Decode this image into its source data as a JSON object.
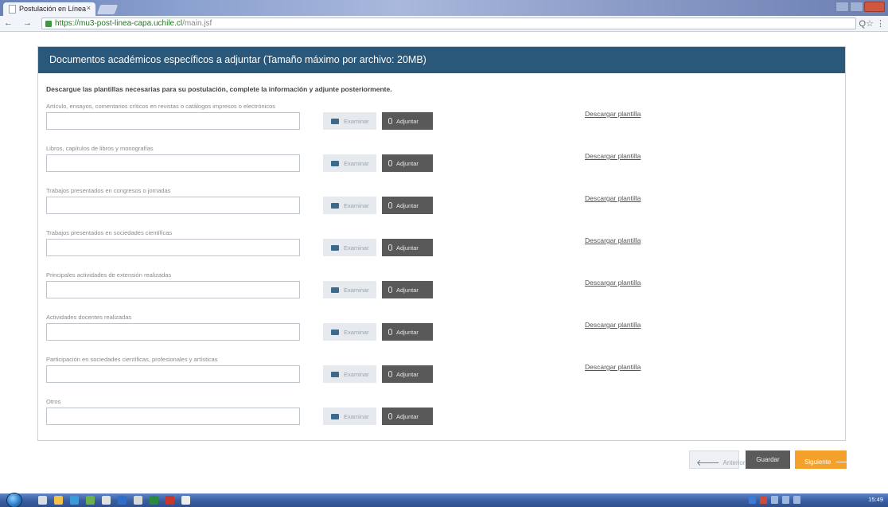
{
  "browser": {
    "tab_title": "Postulación en Línea",
    "tab_close": "×",
    "url_host": "https://mu3-post-linea-capa.uchile.cl",
    "url_path": "/main.jsf",
    "nav_icons": "← → C",
    "right_icons": "Q☆ ⋮"
  },
  "panel": {
    "header": "Documentos académicos específicos a adjuntar (Tamaño máximo por archivo: 20MB)",
    "intro": "Descargue las plantillas necesarias para su postulación, complete la información y adjunte posteriormente."
  },
  "buttons": {
    "browse": "Examinar",
    "attach": "Adjuntar",
    "download_template": "Descargar plantilla"
  },
  "rows": [
    {
      "label": "Artículo, ensayos, comentarios críticos en revistas o catálogos impresos o electrónicos",
      "has_template": true
    },
    {
      "label": "Libros, capítulos de libros y monografías",
      "has_template": true
    },
    {
      "label": "Trabajos presentados en congresos o jornadas",
      "has_template": true
    },
    {
      "label": "Trabajos presentados en sociedades científicas",
      "has_template": true
    },
    {
      "label": "Principales actividades de extensión realizadas",
      "has_template": true
    },
    {
      "label": "Actividades docentes realizadas",
      "has_template": true
    },
    {
      "label": "Participación en sociedades científicas, profesionales y artísticas",
      "has_template": true
    },
    {
      "label": "Otros",
      "has_template": false
    }
  ],
  "footer": {
    "prev": "Anterior",
    "save": "Guardar",
    "next": "Siguiente"
  },
  "taskbar": {
    "clock": "15:49"
  },
  "colors": {
    "header_bg": "#29587a",
    "next_button": "#f4a12c",
    "attach_button": "#595959"
  }
}
